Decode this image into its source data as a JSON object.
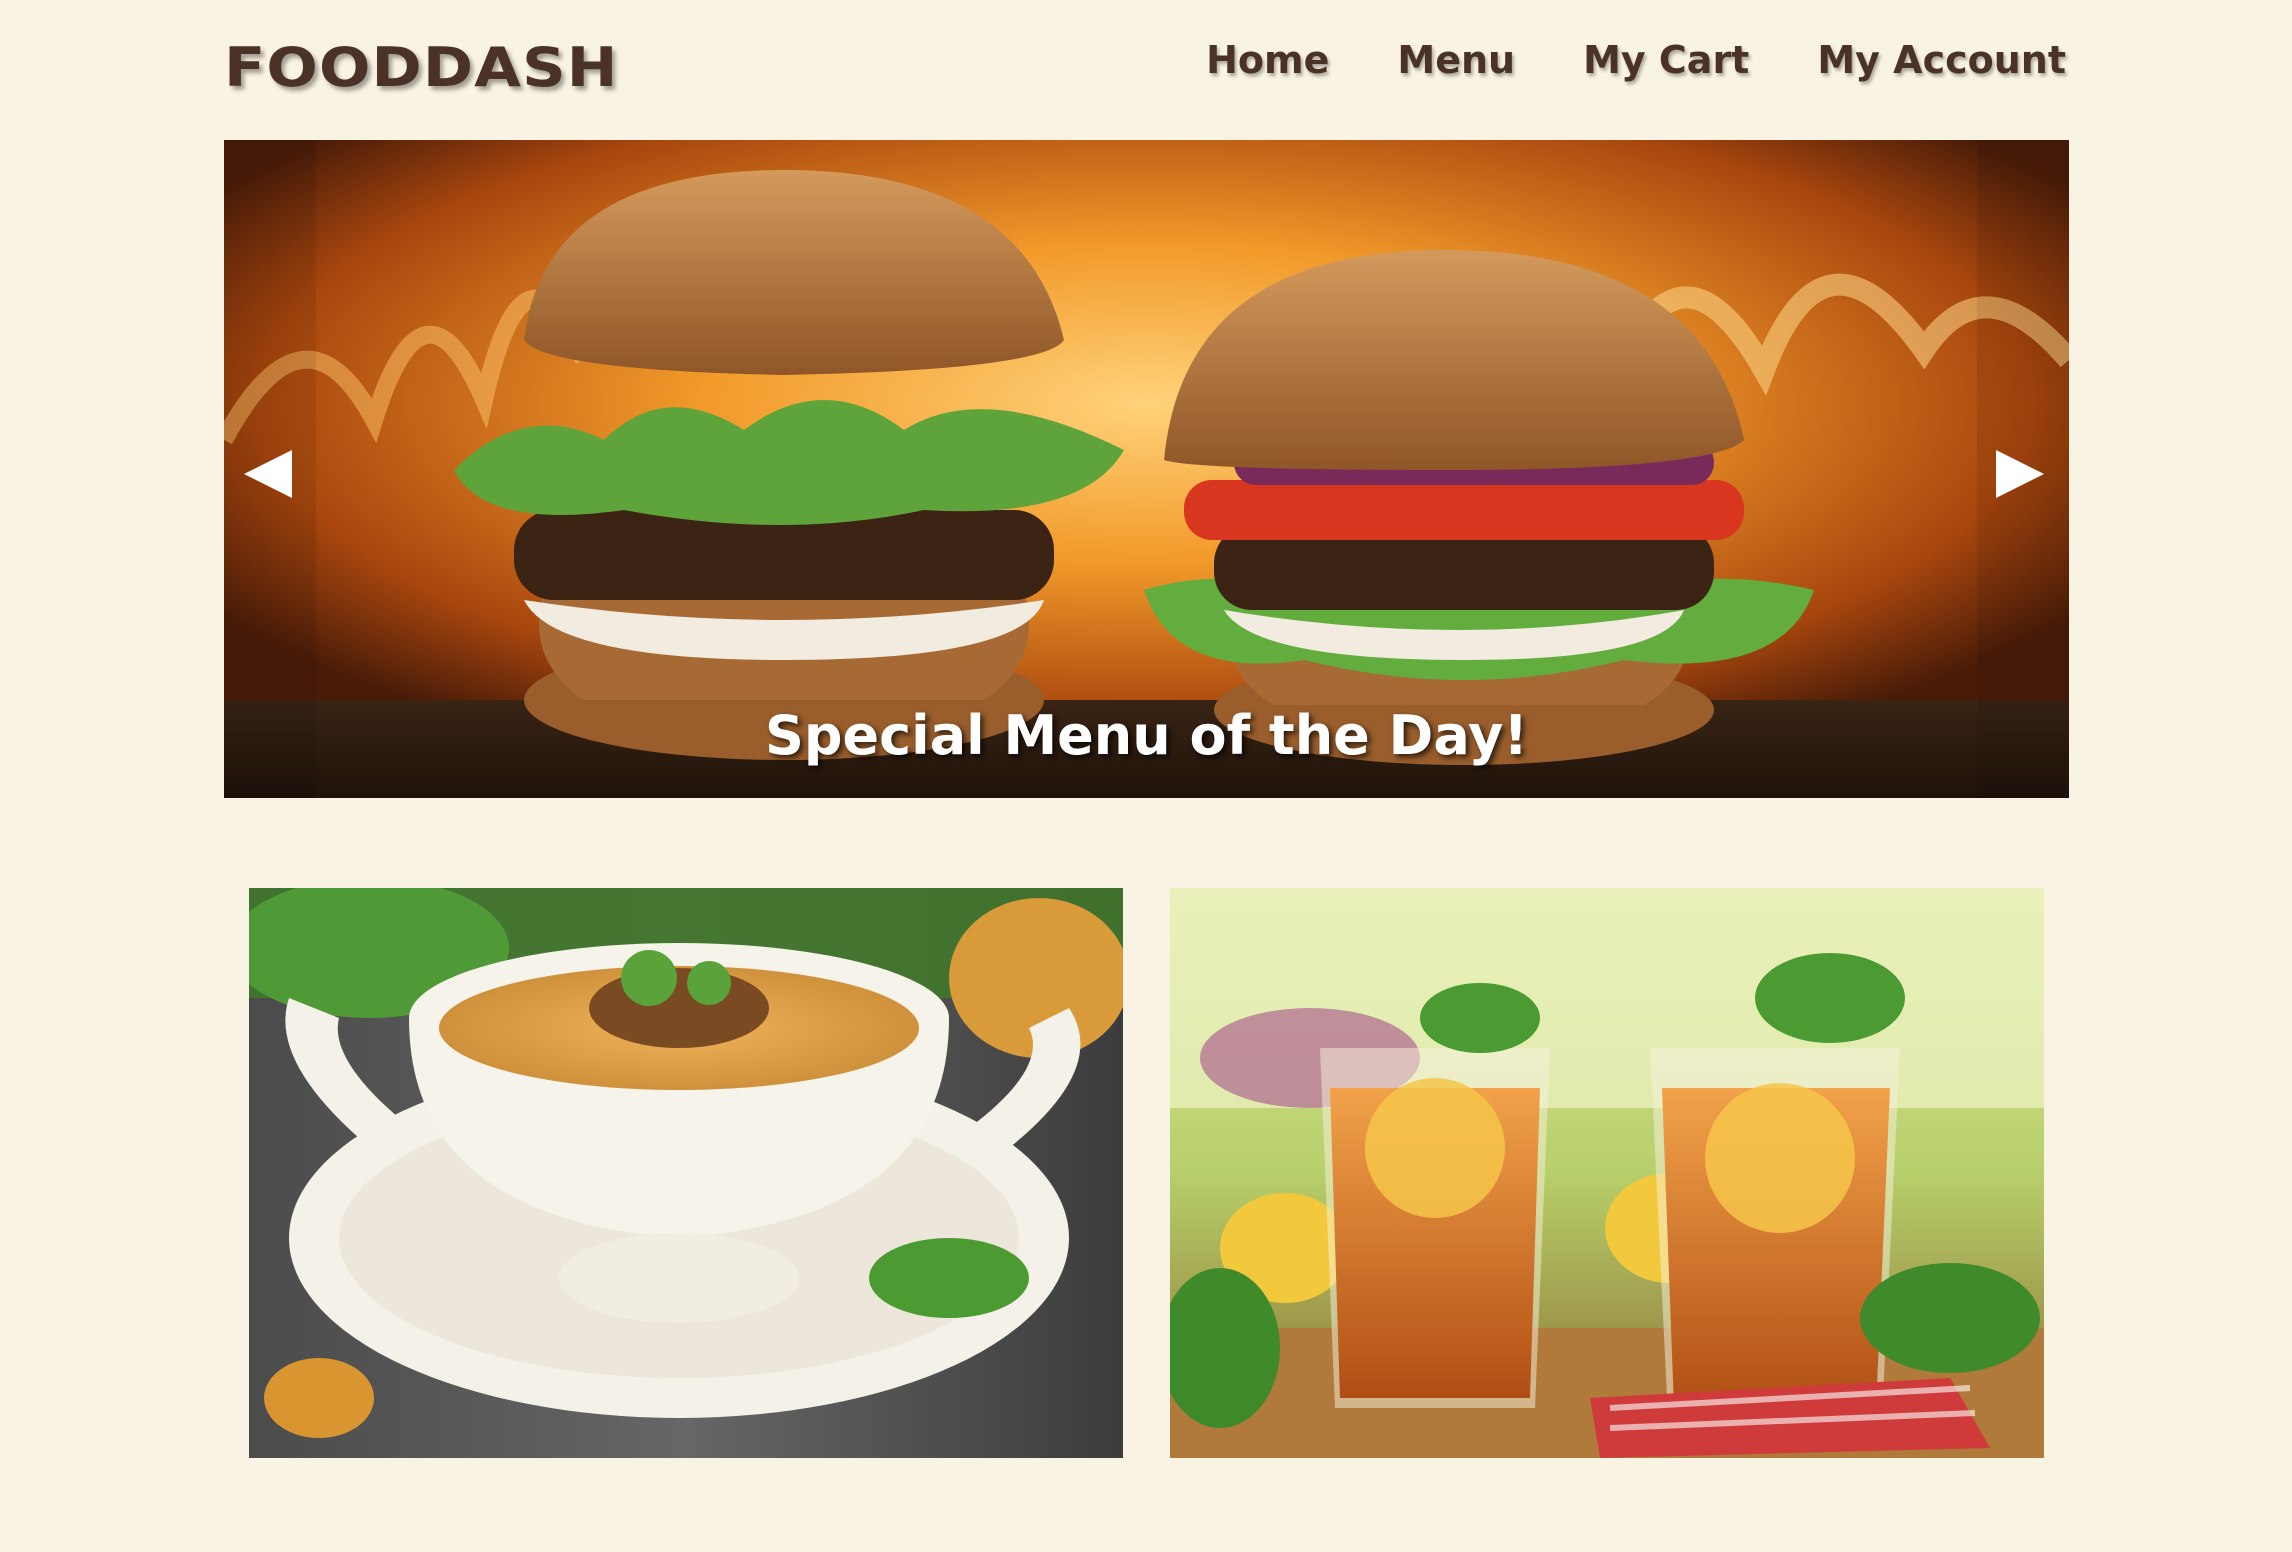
{
  "brand": {
    "name": "FOODDASH"
  },
  "nav": {
    "items": [
      {
        "label": "Home",
        "icon": "none"
      },
      {
        "label": "Menu",
        "icon": "none"
      },
      {
        "label": "My Cart",
        "icon": "none"
      },
      {
        "label": "My Account",
        "icon": "none"
      }
    ]
  },
  "hero": {
    "caption": "Special Menu of the Day!",
    "prev_icon": "triangle-left-icon",
    "next_icon": "triangle-right-icon"
  },
  "cards": [
    {
      "subject": "mushroom-soup-image"
    },
    {
      "subject": "iced-tea-image"
    }
  ],
  "colors": {
    "background": "#f9f3e3",
    "brand_text": "#4a3226",
    "caption_text": "#ffffff"
  }
}
